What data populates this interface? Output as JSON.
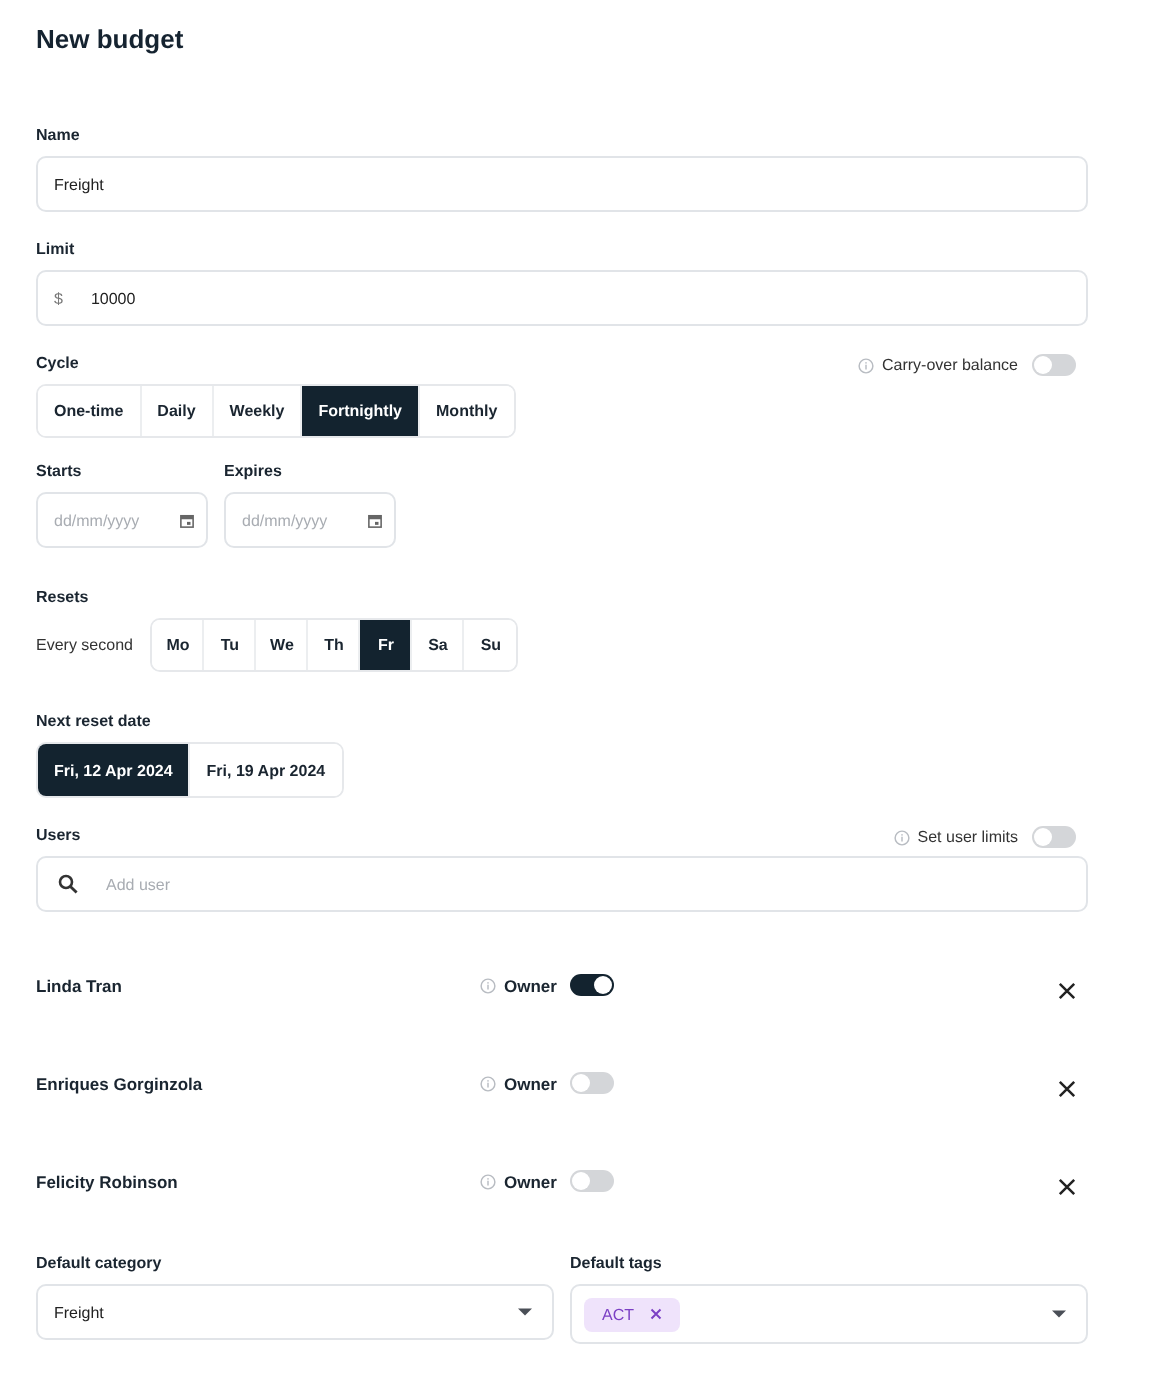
{
  "title": "New budget",
  "name": {
    "label": "Name",
    "value": "Freight"
  },
  "limit": {
    "label": "Limit",
    "currency": "$",
    "value": "10000"
  },
  "cycle": {
    "label": "Cycle",
    "options": [
      {
        "label": "One-time",
        "selected": false
      },
      {
        "label": "Daily",
        "selected": false
      },
      {
        "label": "Weekly",
        "selected": false
      },
      {
        "label": "Fortnightly",
        "selected": true
      },
      {
        "label": "Monthly",
        "selected": false
      }
    ],
    "carry_over": {
      "label": "Carry-over balance",
      "on": false
    }
  },
  "starts": {
    "label": "Starts",
    "placeholder": "dd/mm/yyyy"
  },
  "expires": {
    "label": "Expires",
    "placeholder": "dd/mm/yyyy"
  },
  "resets": {
    "label": "Resets",
    "prefix": "Every second",
    "days": [
      {
        "label": "Mo",
        "selected": false
      },
      {
        "label": "Tu",
        "selected": false
      },
      {
        "label": "We",
        "selected": false
      },
      {
        "label": "Th",
        "selected": false
      },
      {
        "label": "Fr",
        "selected": true
      },
      {
        "label": "Sa",
        "selected": false
      },
      {
        "label": "Su",
        "selected": false
      }
    ]
  },
  "next_reset": {
    "label": "Next reset date",
    "options": [
      {
        "label": "Fri, 12 Apr 2024",
        "selected": true
      },
      {
        "label": "Fri, 19 Apr 2024",
        "selected": false
      }
    ]
  },
  "users": {
    "label": "Users",
    "user_limits": {
      "label": "Set user limits",
      "on": false
    },
    "search_placeholder": "Add user",
    "list": [
      {
        "name": "Linda Tran",
        "owner_label": "Owner",
        "owner": true
      },
      {
        "name": "Enriques Gorginzola",
        "owner_label": "Owner",
        "owner": false
      },
      {
        "name": "Felicity Robinson",
        "owner_label": "Owner",
        "owner": false
      }
    ]
  },
  "default_category": {
    "label": "Default category",
    "value": "Freight"
  },
  "default_tags": {
    "label": "Default tags",
    "tags": [
      "ACT"
    ]
  }
}
